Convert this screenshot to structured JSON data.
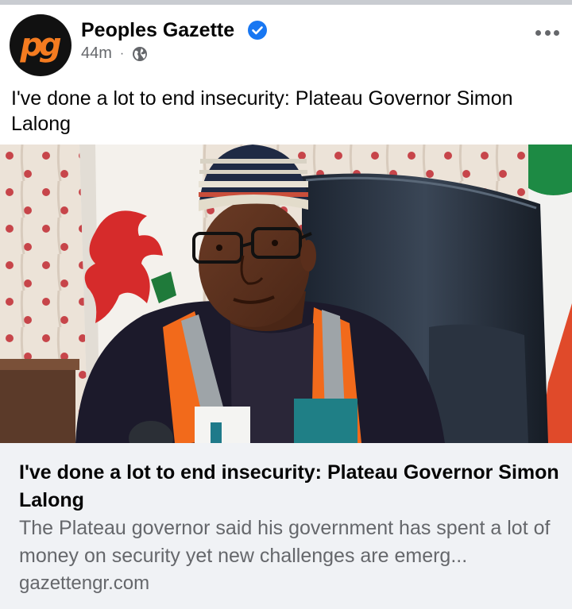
{
  "post": {
    "page_name": "Peoples Gazette",
    "avatar_text": "pg",
    "time": "44m",
    "separator": "·",
    "audience_icon": "globe-icon",
    "verified_icon": "verified-badge-icon",
    "more_icon": "more-options-icon",
    "text": "I've done a lot to end insecurity: Plateau Governor Simon Lalong"
  },
  "link_preview": {
    "title": "I've done a lot to end insecurity: Plateau Governor Simon Lalong",
    "description": "The Plateau governor said his government has spent a lot of money on security yet new challenges are emerg...",
    "domain": "gazettengr.com"
  },
  "colors": {
    "brand_orange": "#f47b20",
    "verified_blue": "#1877f2",
    "secondary_text": "#65676b",
    "card_background": "#f0f2f5"
  }
}
